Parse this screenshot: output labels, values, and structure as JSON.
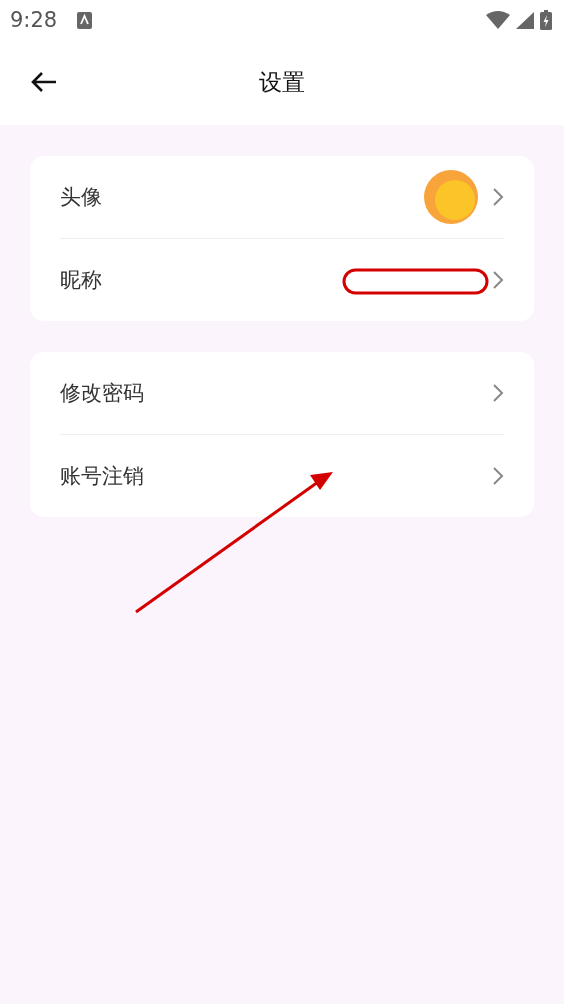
{
  "status_bar": {
    "time": "9:28"
  },
  "header": {
    "title": "设置"
  },
  "groups": [
    {
      "rows": [
        {
          "label": "头像",
          "kind": "avatar"
        },
        {
          "label": "昵称",
          "kind": "plain"
        }
      ]
    },
    {
      "rows": [
        {
          "label": "修改密码",
          "kind": "plain"
        },
        {
          "label": "账号注销",
          "kind": "plain"
        }
      ]
    }
  ]
}
